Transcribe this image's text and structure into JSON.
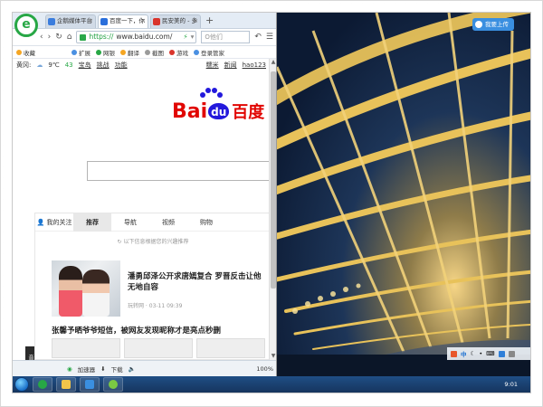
{
  "browser": {
    "logo_letter": "e",
    "tabs": [
      {
        "label": "企鹅媒体平台",
        "color": "#3b7ddd",
        "active": false
      },
      {
        "label": "百度一下，你",
        "color": "#2a6fdb",
        "active": true
      },
      {
        "label": "民安美的 - 多",
        "color": "#d9342b",
        "active": false
      }
    ],
    "new_tab": "+",
    "address": {
      "scheme": "https://",
      "host": "www.baidu.com/",
      "search_placeholder": "O他们"
    },
    "favorites": [
      {
        "label": "收藏",
        "color": "#f5a623"
      },
      {
        "label": "扩展",
        "color": "#4a90e2"
      },
      {
        "label": "网银",
        "color": "#27a745"
      },
      {
        "label": "翻译",
        "color": "#f5a623"
      },
      {
        "label": "截图",
        "color": "#9b9b9b"
      },
      {
        "label": "游戏",
        "color": "#d9342b"
      },
      {
        "label": "登录管家",
        "color": "#4a90e2"
      }
    ],
    "status": {
      "accelerator": "加速器",
      "download": "下载",
      "zoom": "100%"
    }
  },
  "baidu": {
    "top_left": [
      "黄冈:",
      "9℃",
      "43"
    ],
    "top_links_left": [
      "宝岛",
      "挑战",
      "功能"
    ],
    "top_links_right": [
      "糯米",
      "新闻",
      "hao123"
    ],
    "logo_text_a": "Bai",
    "logo_text_du": "du",
    "logo_text_cn": "百度",
    "feed_tabs": [
      "我的关注",
      "推荐",
      "导航",
      "视频",
      "购物"
    ],
    "feed_active": "推荐",
    "feed_note": "以下信息根据您的兴趣推荐",
    "news": [
      {
        "title": "潘勇邱泽公开求唐嫣复合 罗晋反击让他无地自容",
        "source": "玩转网",
        "time": "03-11 09:39"
      },
      {
        "title": "张馨予晒爷爷短信，被网友发现昵称才是亮点秒删"
      }
    ],
    "music_tag": "音乐"
  },
  "desktop": {
    "upload_label": "我要上传",
    "clock": "9:01"
  }
}
